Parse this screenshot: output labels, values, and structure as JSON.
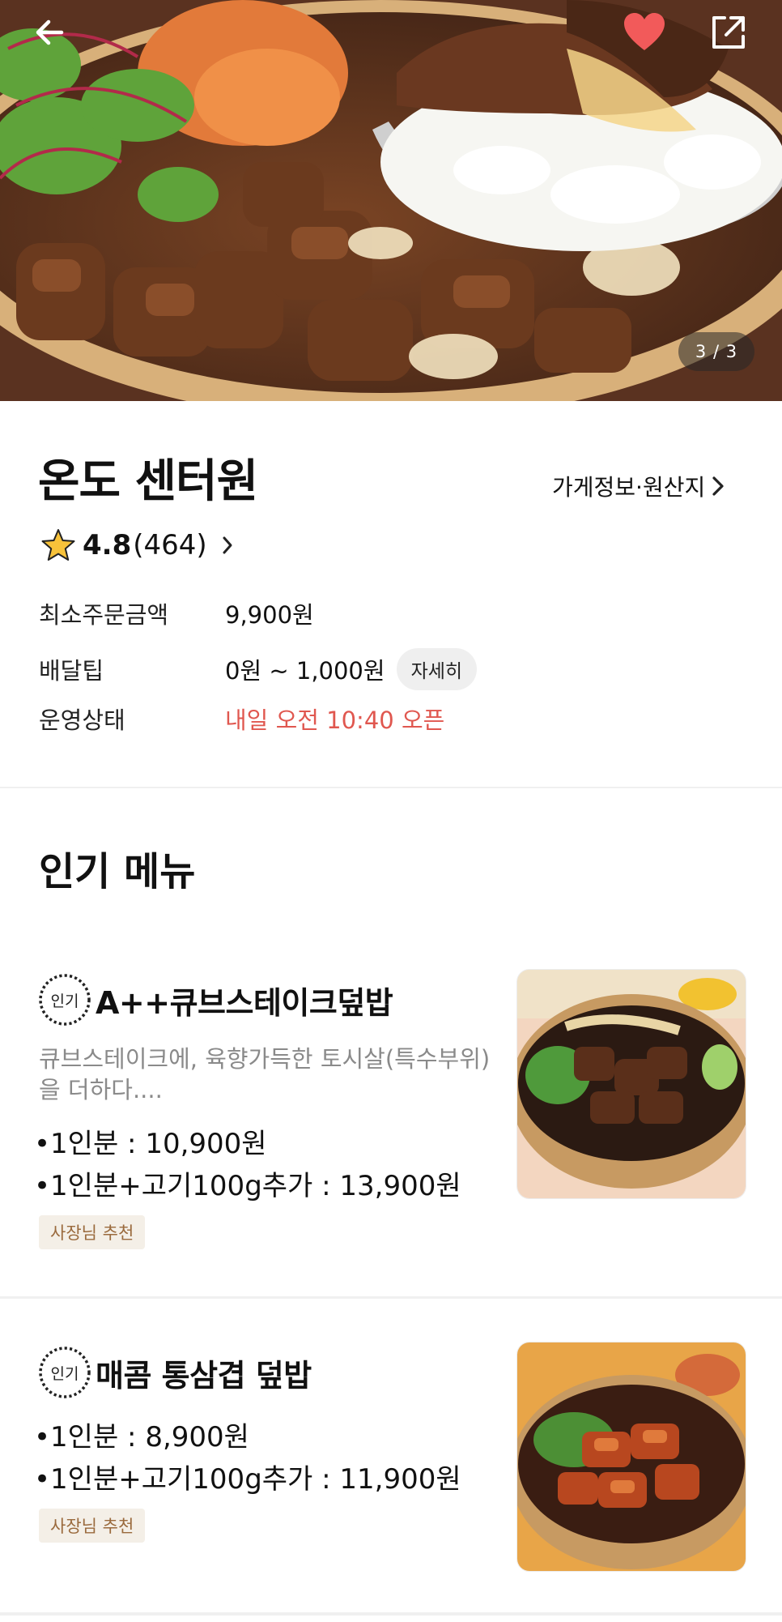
{
  "hero": {
    "page_indicator": "3 / 3",
    "icons": [
      "back-arrow-icon",
      "heart-icon",
      "share-icon"
    ],
    "favorite_color": "#f25a5a"
  },
  "store": {
    "name": "온도 센터원",
    "info_link": "가게정보·원산지",
    "rating": "4.8",
    "review_count": "(464)",
    "min_order_label": "최소주문금액",
    "min_order_value": "9,900원",
    "delivery_tip_label": "배달팁",
    "delivery_tip_value": "0원 ~ 1,000원",
    "detail_button": "자세히",
    "status_label": "운영상태",
    "status_value": "내일 오전 10:40 오픈",
    "status_color": "#e0574f"
  },
  "popular": {
    "title": "인기 메뉴",
    "badge_text": "인기",
    "items": [
      {
        "name": "A++큐브스테이크덮밥",
        "description": "큐브스테이크에, 육향가득한 토시살(특수부위)을 더하다....",
        "prices": [
          "•1인분 : 10,900원",
          "•1인분+고기100g추가 : 13,900원"
        ],
        "tag": "사장님 추천"
      },
      {
        "name": "매콤 통삼겹 덮밥",
        "prices": [
          "•1인분 : 8,900원",
          "•1인분+고기100g추가 : 11,900원"
        ],
        "tag": "사장님 추천"
      }
    ]
  }
}
